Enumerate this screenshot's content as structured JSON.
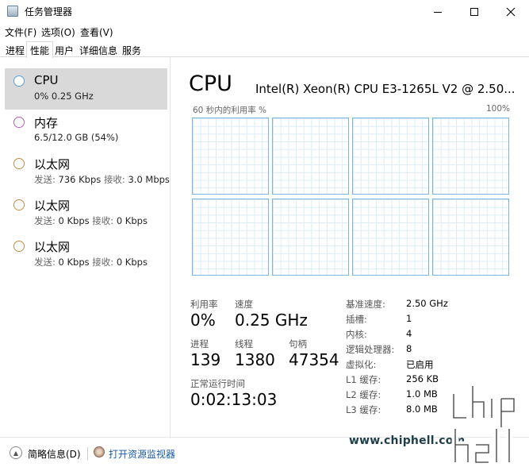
{
  "window": {
    "title": "任务管理器"
  },
  "menu": {
    "items": [
      "文件(F)",
      "选项(O)",
      "查看(V)"
    ]
  },
  "tabs": [
    "进程",
    "性能",
    "用户",
    "详细信息",
    "服务"
  ],
  "sidebar": {
    "items": [
      {
        "name": "CPU",
        "sub": "0%  0.25 GHz",
        "ring_color": "#5aa0d8"
      },
      {
        "name": "内存",
        "sub": "6.5/12.0 GB (54%)",
        "ring_color": "#b25fc5"
      },
      {
        "name": "以太网",
        "send_label": "发送:",
        "send": "736 Kbps",
        "recv_label": "接收:",
        "recv": "3.0 Mbps",
        "ring_color": "#c98a47"
      },
      {
        "name": "以太网",
        "send_label": "发送:",
        "send": "0 Kbps",
        "recv_label": "接收:",
        "recv": "0 Kbps",
        "ring_color": "#c98a47"
      },
      {
        "name": "以太网",
        "send_label": "发送:",
        "send": "0 Kbps",
        "recv_label": "接收:",
        "recv": "0 Kbps",
        "ring_color": "#c98a47"
      }
    ]
  },
  "main": {
    "title": "CPU",
    "model": "Intel(R) Xeon(R) CPU E3-1265L V2 @ 2.50...",
    "graph_label": "60 秒内的利用率 %",
    "graph_max": "100%",
    "core_count": 8,
    "stats": {
      "util_label": "利用率",
      "util": "0%",
      "speed_label": "速度",
      "speed": "0.25 GHz",
      "proc_label": "进程",
      "proc": "139",
      "thread_label": "线程",
      "thread": "1380",
      "handle_label": "句柄",
      "handle": "47354",
      "uptime_label": "正常运行时间",
      "uptime": "0:02:13:03"
    },
    "specs": [
      {
        "key": "基准速度:",
        "val": "2.50 GHz"
      },
      {
        "key": "插槽:",
        "val": "1"
      },
      {
        "key": "内核:",
        "val": "4"
      },
      {
        "key": "逻辑处理器:",
        "val": "8"
      },
      {
        "key": "虚拟化:",
        "val": "已启用"
      },
      {
        "key": "L1 缓存:",
        "val": "256 KB"
      },
      {
        "key": "L2 缓存:",
        "val": "1.0 MB"
      },
      {
        "key": "L3 缓存:",
        "val": "8.0 MB"
      }
    ]
  },
  "footer": {
    "fewer_details": "简略信息(D)",
    "open_monitor": "打开资源监视器"
  },
  "watermark": {
    "url": "www.chiphell.com",
    "logo": "chip hell"
  },
  "colors": {
    "accent": "#5aa0d8",
    "selected_bg": "#d9d9d9",
    "link": "#1a5aa8"
  }
}
